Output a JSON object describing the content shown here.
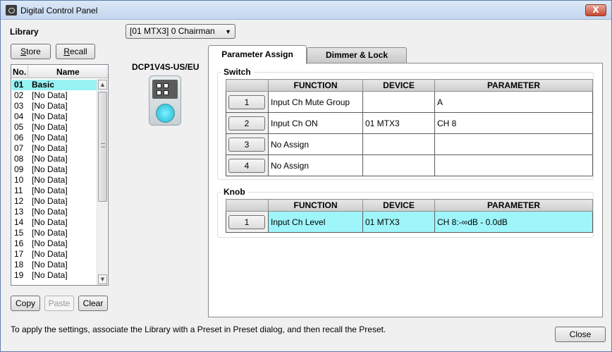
{
  "window": {
    "title": "Digital Control Panel",
    "close_glyph": "X"
  },
  "library": {
    "label": "Library",
    "store_label_first": "S",
    "store_label_rest": "tore",
    "recall_label_first": "R",
    "recall_label_rest": "ecall",
    "col_no": "No.",
    "col_name": "Name",
    "items": [
      {
        "no": "01",
        "name": "Basic"
      },
      {
        "no": "02",
        "name": "[No Data]"
      },
      {
        "no": "03",
        "name": "[No Data]"
      },
      {
        "no": "04",
        "name": "[No Data]"
      },
      {
        "no": "05",
        "name": "[No Data]"
      },
      {
        "no": "06",
        "name": "[No Data]"
      },
      {
        "no": "07",
        "name": "[No Data]"
      },
      {
        "no": "08",
        "name": "[No Data]"
      },
      {
        "no": "09",
        "name": "[No Data]"
      },
      {
        "no": "10",
        "name": "[No Data]"
      },
      {
        "no": "11",
        "name": "[No Data]"
      },
      {
        "no": "12",
        "name": "[No Data]"
      },
      {
        "no": "13",
        "name": "[No Data]"
      },
      {
        "no": "14",
        "name": "[No Data]"
      },
      {
        "no": "15",
        "name": "[No Data]"
      },
      {
        "no": "16",
        "name": "[No Data]"
      },
      {
        "no": "17",
        "name": "[No Data]"
      },
      {
        "no": "18",
        "name": "[No Data]"
      },
      {
        "no": "19",
        "name": "[No Data]"
      }
    ],
    "copy_label": "Copy",
    "paste_label": "Paste",
    "clear_label": "Clear"
  },
  "device_select": {
    "value": "[01 MTX3] 0 Chairman",
    "arrow": "▼"
  },
  "device": {
    "model": "DCP1V4S-US/EU"
  },
  "tabs": {
    "parameter_assign": "Parameter Assign",
    "dimmer_lock": "Dimmer & Lock"
  },
  "switch": {
    "title": "Switch",
    "headers": {
      "function": "FUNCTION",
      "device": "DEVICE",
      "parameter": "PARAMETER"
    },
    "rows": [
      {
        "num": "1",
        "function": "Input Ch Mute Group",
        "device": "",
        "parameter": "A"
      },
      {
        "num": "2",
        "function": "Input Ch ON",
        "device": "01 MTX3",
        "parameter": "CH 8"
      },
      {
        "num": "3",
        "function": "No Assign",
        "device": "",
        "parameter": ""
      },
      {
        "num": "4",
        "function": "No Assign",
        "device": "",
        "parameter": ""
      }
    ]
  },
  "knob": {
    "title": "Knob",
    "headers": {
      "function": "FUNCTION",
      "device": "DEVICE",
      "parameter": "PARAMETER"
    },
    "rows": [
      {
        "num": "1",
        "function": "Input Ch Level",
        "device": "01 MTX3",
        "parameter": "CH 8:-∞dB - 0.0dB"
      }
    ]
  },
  "footer": {
    "hint": "To apply the settings, associate the Library with a Preset in Preset dialog, and then recall the Preset.",
    "close_label": "Close"
  }
}
